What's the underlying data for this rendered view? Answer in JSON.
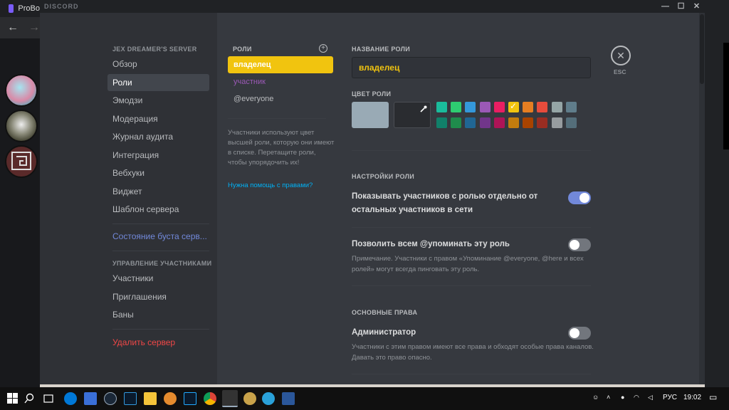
{
  "browser": {
    "tab_title": "ProBo",
    "back_icon": "←",
    "forward_icon": "→"
  },
  "window": {
    "app_name": "DISCORD",
    "minimize": "—",
    "maximize": "☐",
    "close": "✕"
  },
  "sidebar": {
    "server_header": "JEX DREAMER'S SERVER",
    "items": [
      "Обзор",
      "Роли",
      "Эмодзи",
      "Модерация",
      "Журнал аудита",
      "Интеграция",
      "Вебхуки",
      "Виджет",
      "Шаблон сервера"
    ],
    "selected": "Роли",
    "boost": "Состояние буста серв...",
    "members_header": "УПРАВЛЕНИЕ УЧАСТНИКАМИ",
    "member_items": [
      "Участники",
      "Приглашения",
      "Баны"
    ],
    "delete": "Удалить сервер"
  },
  "roles": {
    "header": "РОЛИ",
    "plus_icon": "+",
    "list": [
      "владелец",
      "участник",
      "@everyone"
    ],
    "note": "Участники используют цвет высшей роли, которую они имеют в списке. Перетащите роли, чтобы упорядочить их!",
    "help_link": "Нужна помощь с правами?"
  },
  "settings": {
    "role_name_label": "НАЗВАНИЕ РОЛИ",
    "role_name_value": "владелец",
    "role_color_label": "ЦВЕТ РОЛИ",
    "color_selected": "#f1c40f",
    "colors_row1": [
      "#1abc9c",
      "#2ecc71",
      "#3498db",
      "#9b59b6",
      "#e91e63",
      "#f1c40f",
      "#e67e22",
      "#e74c3c",
      "#95a5a6",
      "#607d8b"
    ],
    "colors_row2": [
      "#11806a",
      "#1f8b4c",
      "#206694",
      "#71368a",
      "#ad1457",
      "#c27c0e",
      "#a84300",
      "#992d22",
      "#979c9f",
      "#546e7a"
    ],
    "role_settings_label": "НАСТРОЙКИ РОЛИ",
    "hoist_title": "Показывать участников с ролью отдельно от остальных участников в сети",
    "hoist_on": true,
    "mention_title": "Позволить всем @упоминать эту роль",
    "mention_on": false,
    "mention_note": "Примечание. Участники с правом «Упоминание @everyone, @here и всех ролей» могут всегда пинговать эту роль.",
    "basic_perms_label": "ОСНОВНЫЕ ПРАВА",
    "admin_title": "Администратор",
    "admin_on": false,
    "admin_note": "Участники с этим правом имеют все права и обходят особые права каналов. Давать это право опасно.",
    "esc_icon": "✕",
    "esc_label": "ESC"
  },
  "taskbar": {
    "lang": "РУС",
    "time": "19:02",
    "notification_icon": "▭"
  }
}
